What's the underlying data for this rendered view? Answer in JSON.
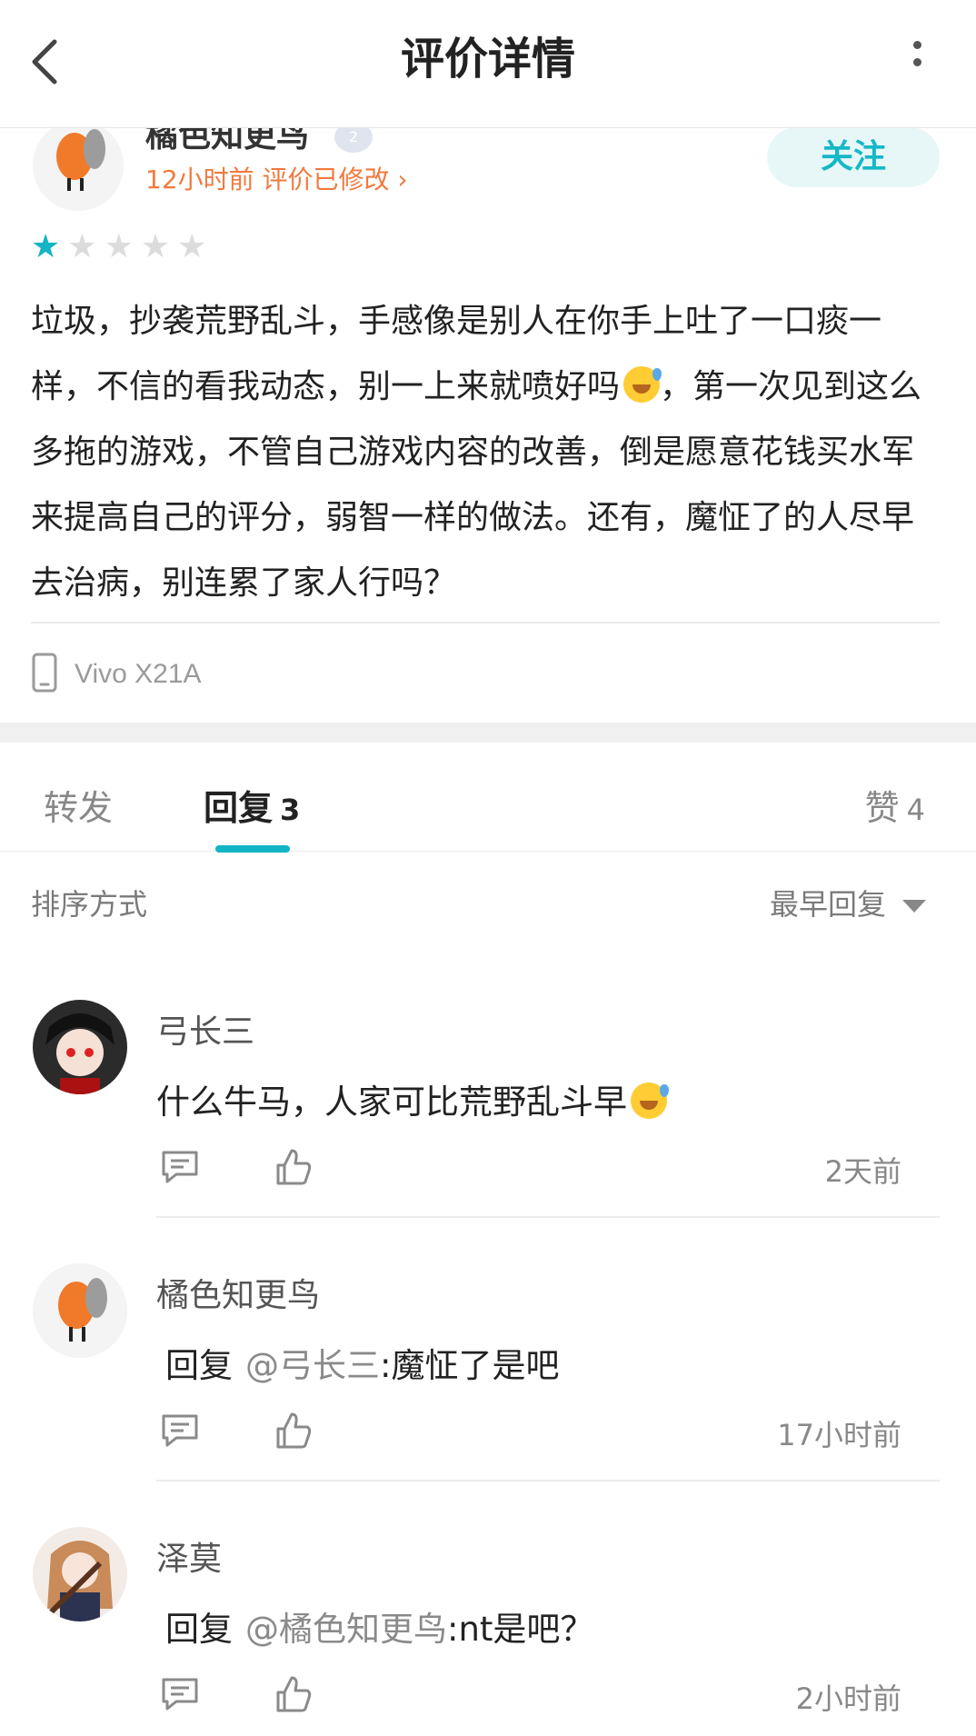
{
  "header": {
    "title": "评价详情",
    "back_icon": "back-arrow-icon",
    "more_icon": "more-vertical-icon"
  },
  "author": {
    "name": "橘色知更鸟",
    "meta": "12小时前 评价已修改 ›",
    "follow_label": "关注",
    "level_badge": "2"
  },
  "review": {
    "rating": 1,
    "rating_max": 5,
    "text_parts": [
      "垃圾，抄袭荒野乱斗，手感像是别人在你手上吐了一口痰一样，不信的看我动态，别一上来就喷好吗",
      "，第一次见到这么多拖的游戏，不管自己游戏内容的改善，倒是愿意花钱买水军来提高自己的评分，弱智一样的做法。还有，魔怔了的人尽早去治病，别连累了家人行吗？"
    ],
    "device": "Vivo X21A"
  },
  "tabs": [
    {
      "label": "转发",
      "count": ""
    },
    {
      "label": "回复",
      "count": "3"
    },
    {
      "label": "赞",
      "count": "4"
    }
  ],
  "sort": {
    "label": "排序方式",
    "value": "最早回复"
  },
  "comments": [
    {
      "name": "弓长三",
      "text": "什么牛马，人家可比荒野乱斗早",
      "reply_prefix": "",
      "mention": "",
      "time": "2天前"
    },
    {
      "name": "橘色知更鸟",
      "text": ":魔怔了是吧",
      "reply_prefix": "回复",
      "mention": "@弓长三",
      "time": "17小时前"
    },
    {
      "name": "泽莫",
      "text": ":nt是吧？",
      "reply_prefix": "回复",
      "mention": "@橘色知更鸟",
      "time": "2小时前"
    }
  ],
  "colors": {
    "accent": "#13b4c6",
    "meta_orange": "#f07a3e",
    "follow_bg": "#e7f7f8"
  }
}
